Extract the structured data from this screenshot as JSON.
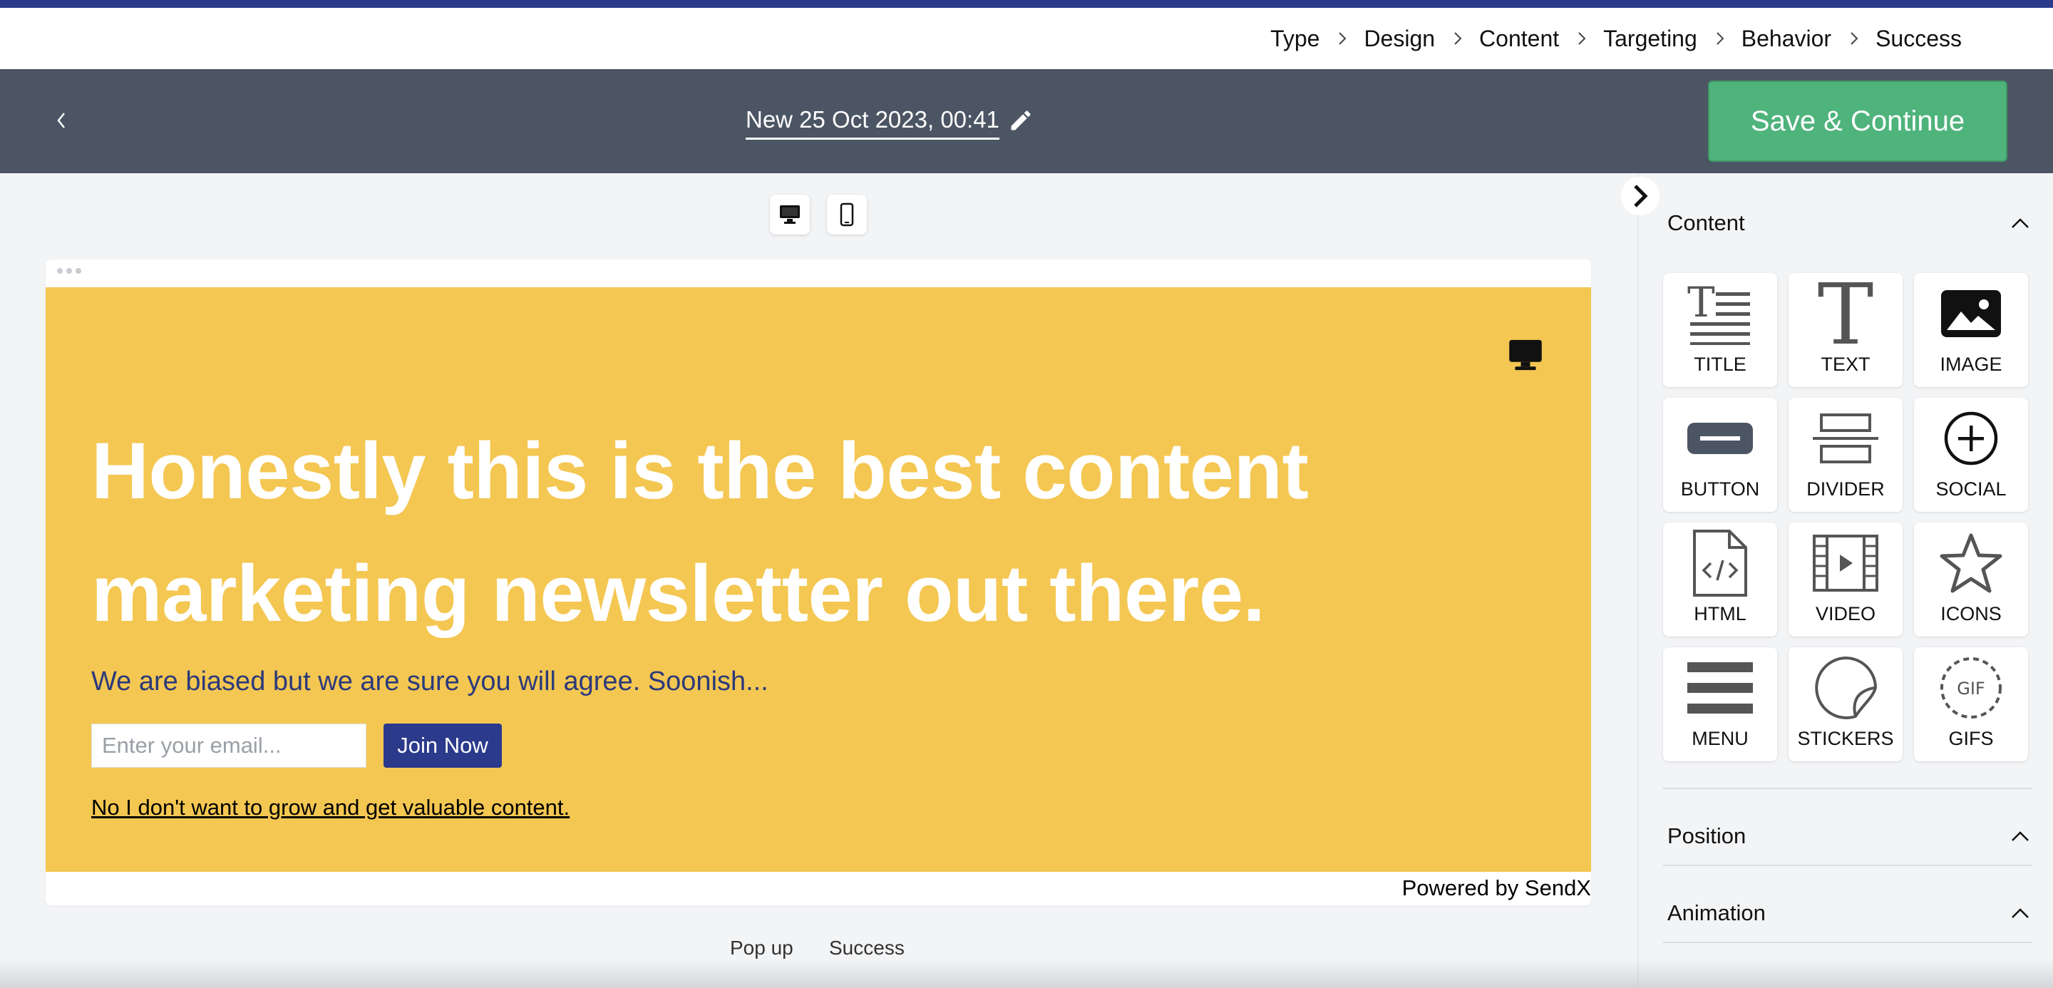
{
  "breadcrumbs": [
    "Type",
    "Design",
    "Content",
    "Targeting",
    "Behavior",
    "Success"
  ],
  "toolbar": {
    "doc_title": "New 25 Oct 2023, 00:41",
    "save_label": "Save & Continue"
  },
  "popup": {
    "headline_line1": "Honestly this is the best content",
    "headline_line2": "marketing newsletter out there.",
    "subtext": "We are biased but we are sure you will agree. Soonish...",
    "email_placeholder": "Enter your email...",
    "join_label": "Join Now",
    "decline_link": "No I don't want to grow and get valuable content.",
    "powered_by": "Powered by SendX",
    "background_color": "#f4c752",
    "accent_color": "#2c3a8c"
  },
  "bottom_tabs": [
    "Pop up",
    "Success"
  ],
  "sidebar": {
    "content_label": "Content",
    "position_label": "Position",
    "animation_label": "Animation",
    "tiles": [
      {
        "label": "TITLE",
        "icon": "title-icon"
      },
      {
        "label": "TEXT",
        "icon": "text-icon"
      },
      {
        "label": "IMAGE",
        "icon": "image-icon"
      },
      {
        "label": "BUTTON",
        "icon": "button-icon"
      },
      {
        "label": "DIVIDER",
        "icon": "divider-icon"
      },
      {
        "label": "SOCIAL",
        "icon": "social-icon"
      },
      {
        "label": "HTML",
        "icon": "html-icon"
      },
      {
        "label": "VIDEO",
        "icon": "video-icon"
      },
      {
        "label": "ICONS",
        "icon": "star-icon"
      },
      {
        "label": "MENU",
        "icon": "menu-icon"
      },
      {
        "label": "STICKERS",
        "icon": "sticker-icon"
      },
      {
        "label": "GIFS",
        "icon": "gif-icon"
      }
    ]
  },
  "colors": {
    "save_button": "#4fb37c",
    "toolbar": "#4b5563",
    "top_stripe": "#2c3a8c"
  }
}
